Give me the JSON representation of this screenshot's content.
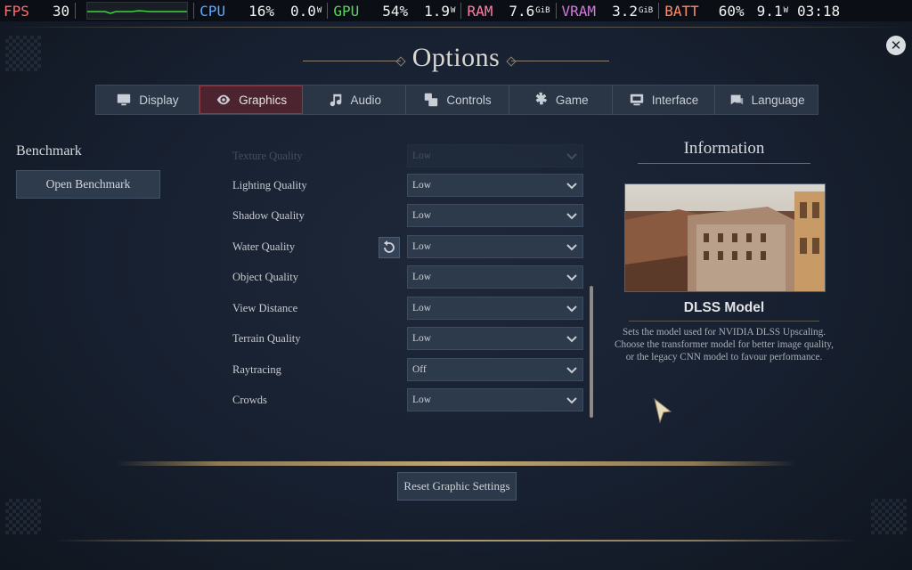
{
  "perf": {
    "fps_label": "FPS",
    "fps_value": "30",
    "cpu_label": "CPU",
    "cpu_usage": "16%",
    "cpu_power": "0.0",
    "cpu_power_unit": "W",
    "gpu_label": "GPU",
    "gpu_usage": "54%",
    "gpu_power": "1.9",
    "gpu_power_unit": "W",
    "ram_label": "RAM",
    "ram_value": "7.6",
    "ram_unit": "GiB",
    "vram_label": "VRAM",
    "vram_value": "3.2",
    "vram_unit": "GiB",
    "batt_label": "BATT",
    "batt_percent": "60%",
    "batt_power": "9.1",
    "batt_power_unit": "W",
    "clock": "03:18",
    "colors": {
      "fps": "#ff6b6b",
      "cpu": "#5aa9ff",
      "gpu": "#5fd35f",
      "ram": "#ff7fa3",
      "vram": "#d07bd8",
      "batt": "#ff8a66"
    }
  },
  "title": "Options",
  "tabs": [
    {
      "label": "Display",
      "icon": "monitor-icon",
      "active": false
    },
    {
      "label": "Graphics",
      "icon": "eye-icon",
      "active": true
    },
    {
      "label": "Audio",
      "icon": "music-note-icon",
      "active": false
    },
    {
      "label": "Controls",
      "icon": "controls-icon",
      "active": false
    },
    {
      "label": "Game",
      "icon": "gear-icon",
      "active": false
    },
    {
      "label": "Interface",
      "icon": "interface-icon",
      "active": false
    },
    {
      "label": "Language",
      "icon": "language-icon",
      "active": false
    }
  ],
  "benchmark": {
    "heading": "Benchmark",
    "button": "Open Benchmark"
  },
  "settings": [
    {
      "label": "Texture Quality",
      "value": "Low",
      "faded": true
    },
    {
      "label": "Lighting Quality",
      "value": "Low"
    },
    {
      "label": "Shadow Quality",
      "value": "Low"
    },
    {
      "label": "Water Quality",
      "value": "Low",
      "reset": true
    },
    {
      "label": "Object Quality",
      "value": "Low"
    },
    {
      "label": "View Distance",
      "value": "Low"
    },
    {
      "label": "Terrain Quality",
      "value": "Low"
    },
    {
      "label": "Raytracing",
      "value": "Off"
    },
    {
      "label": "Crowds",
      "value": "Low"
    }
  ],
  "info": {
    "heading": "Information",
    "subtitle": "DLSS Model",
    "description": "Sets the model used for NVIDIA DLSS Upscaling. Choose the transformer model for better image quality, or the legacy CNN model to favour performance."
  },
  "reset_button": "Reset Graphic Settings",
  "accent_colors": {
    "active_tab": "#4b2430",
    "gold": "#c0a676"
  }
}
